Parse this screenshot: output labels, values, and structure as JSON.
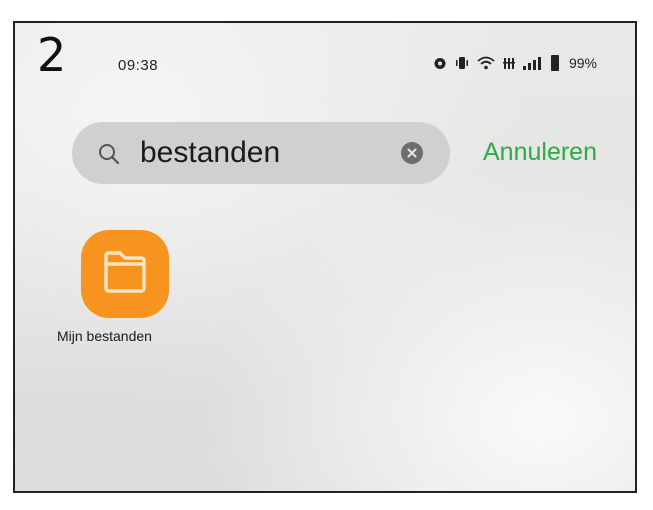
{
  "step": "2",
  "status_bar": {
    "time": "09:38",
    "battery": "99%",
    "icons": [
      "alarm-icon",
      "vibrate-icon",
      "wifi-icon",
      "network-4g-icon",
      "signal-icon",
      "battery-icon"
    ]
  },
  "search": {
    "query": "bestanden",
    "cancel_label": "Annuleren",
    "icon": "search-icon",
    "clear_icon": "clear-icon"
  },
  "results": [
    {
      "label": "Mijn bestanden",
      "icon": "folder-icon",
      "color": "#f7931f"
    }
  ],
  "colors": {
    "accent": "#2daa4a",
    "app_icon": "#f7931f"
  }
}
